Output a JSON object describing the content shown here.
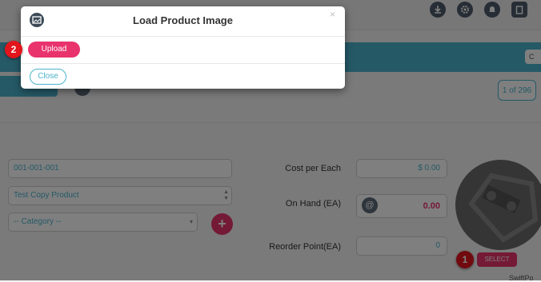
{
  "modal": {
    "title": "Load Product Image",
    "close_glyph": "×",
    "upload_label": "Upload",
    "close_label": "Close"
  },
  "pager": {
    "text": "1 of 296"
  },
  "form": {
    "code_value": "001-001-001",
    "name_value": "Test Copy Product",
    "category_value": "-- Category --",
    "cost_label": "Cost per Each",
    "cost_value": "$ 0.00",
    "onhand_label": "On Hand (EA)",
    "onhand_value": "0.00",
    "reorder_label": "Reorder Point(EA)",
    "reorder_value": "0"
  },
  "photo": {
    "select_label": "SELECT"
  },
  "markers": {
    "one": "1",
    "two": "2"
  },
  "teal_button": "C",
  "cutoff_text": "SwiftPo",
  "colors": {
    "accent_pink": "#e8336c",
    "teal": "#4ab3cc",
    "marker_red": "#e2141c"
  },
  "icons": [
    "download-icon",
    "gear-icon",
    "bell-icon",
    "clipboard-icon",
    "image-gallery-icon",
    "dollar-icon",
    "plus-icon"
  ]
}
